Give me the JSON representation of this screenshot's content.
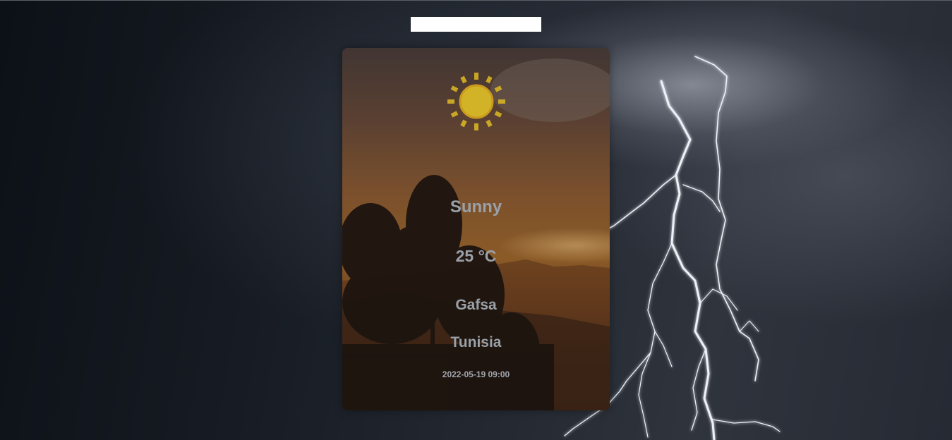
{
  "search": {
    "value": "",
    "placeholder": ""
  },
  "weather": {
    "icon": "sun-icon",
    "condition": "Sunny",
    "temperature": "25 °C",
    "city": "Gafsa",
    "country": "Tunisia",
    "datetime": "2022-05-19 09:00"
  },
  "colors": {
    "sun": "#d6b324",
    "text": "#9aa0a8"
  }
}
